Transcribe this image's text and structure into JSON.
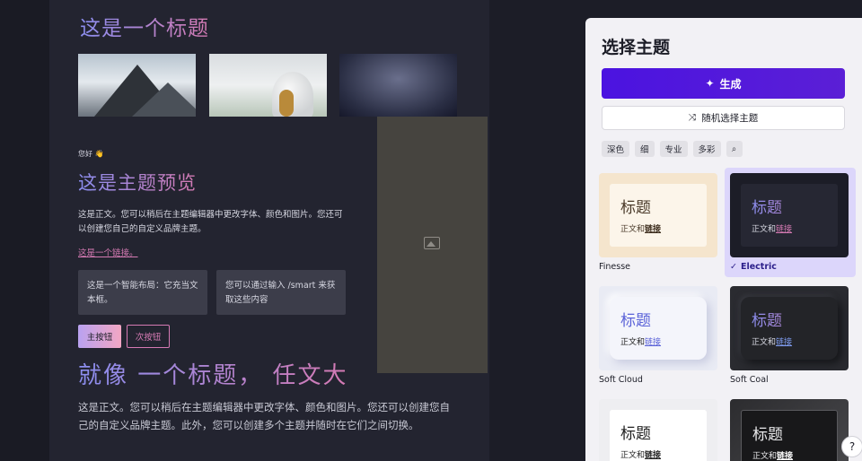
{
  "preview": {
    "hero_title": "这是一个标题",
    "greeting": "您好 👋",
    "title": "这是主题预览",
    "body": "这是正文。您可以稍后在主题编辑器中更改字体、颜色和图片。您还可以创建您自己的自定义品牌主题。",
    "link": "这是一个链接。",
    "smart_box_1": "这是一个智能布局：它充当文本框。",
    "smart_box_2": "您可以通过输入 /smart 来获取这些内容",
    "primary_button": "主按钮",
    "secondary_button": "次按钮",
    "big_heading": "就像 一个标题， 任文大",
    "long_body": "这是正文。您可以稍后在主题编辑器中更改字体、颜色和图片。您还可以创建您自己的自定义品牌主题。此外，您可以创建多个主题并随时在它们之间切换。"
  },
  "panel": {
    "title": "选择主题",
    "generate_label": "生成",
    "random_label": "随机选择主题",
    "filters": [
      "深色",
      "细",
      "专业",
      "多彩"
    ],
    "card_title": "标题",
    "card_body": "正文和",
    "card_link": "链接",
    "themes": [
      "Finesse",
      "Electric",
      "Soft Cloud",
      "Soft Coal"
    ],
    "selected_theme": "Electric"
  },
  "help_label": "?",
  "colors": {
    "accent": "#4b13e0",
    "link_pink": "#d57ab3",
    "canvas_bg": "#232430",
    "panel_bg": "#f2f1f5"
  }
}
